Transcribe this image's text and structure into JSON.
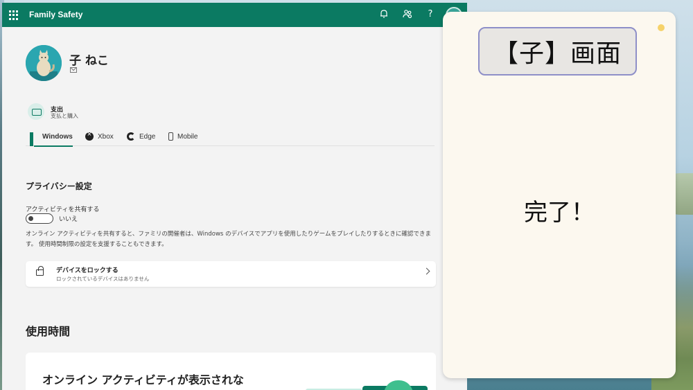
{
  "app": {
    "title": "Family Safety",
    "header_icons": [
      "bell-icon",
      "family-settings-icon",
      "help-icon",
      "profile-avatar"
    ],
    "help_glyph": "?"
  },
  "profile": {
    "name": "子 ねこ"
  },
  "spending": {
    "title": "支出",
    "subtitle": "支払と購入"
  },
  "tabs": [
    {
      "label": "Windows",
      "icon": "windows-icon",
      "active": true
    },
    {
      "label": "Xbox",
      "icon": "xbox-icon",
      "active": false
    },
    {
      "label": "Edge",
      "icon": "edge-icon",
      "active": false
    },
    {
      "label": "Mobile",
      "icon": "mobile-icon",
      "active": false
    }
  ],
  "privacy": {
    "title": "プライバシー設定",
    "share_label": "アクティビティを共有する",
    "toggle_state": "いいえ",
    "description": "オンライン アクティビティを共有すると、ファミリの開催者は、Windows のデバイスでアプリを使用したりゲームをプレイしたりするときに確認できます。 使用時間制限の設定を支援することもできます。"
  },
  "lock_device": {
    "title": "デバイスをロックする",
    "subtitle": "ロックされているデバイスはありません"
  },
  "usage": {
    "title": "使用時間",
    "card_text": "オンライン アクティビティが表示されな"
  },
  "overlay": {
    "label": "【子】画面",
    "message": "完了！"
  },
  "colors": {
    "brand": "#0b7a62",
    "panel_bg": "#fcf8ef",
    "label_border": "#8e8fc8",
    "dot": "#f6d26a"
  }
}
